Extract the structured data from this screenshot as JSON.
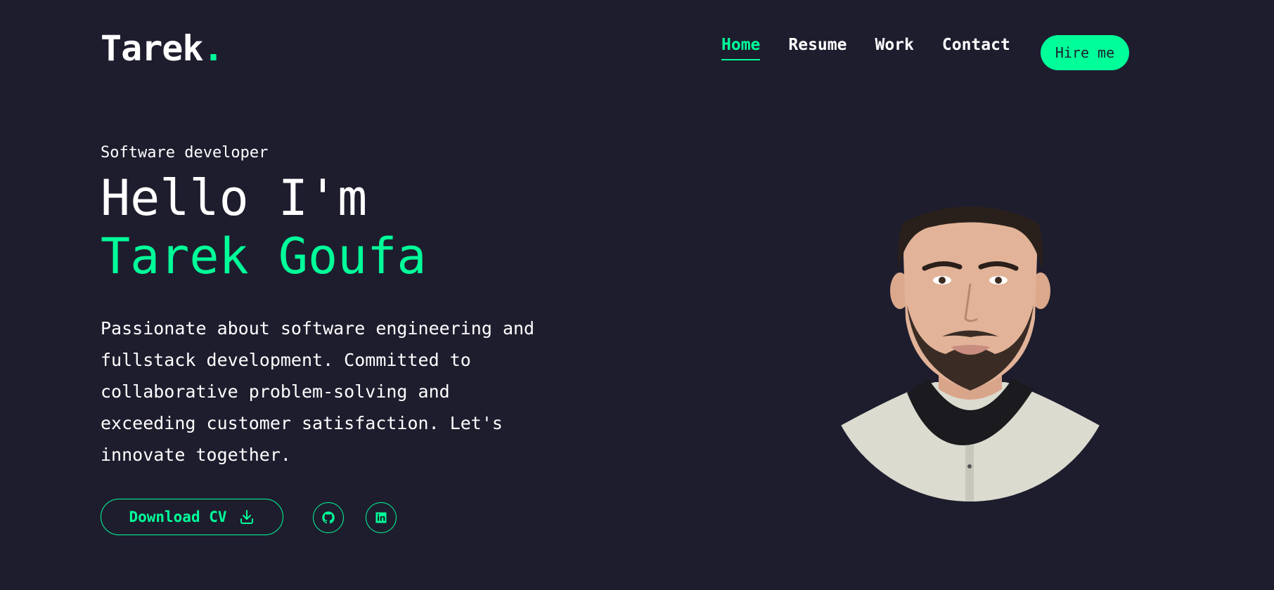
{
  "header": {
    "logo_text": "Tarek",
    "logo_dot": ".",
    "nav": [
      {
        "label": "Home",
        "active": true
      },
      {
        "label": "Resume",
        "active": false
      },
      {
        "label": "Work",
        "active": false
      },
      {
        "label": "Contact",
        "active": false
      }
    ],
    "hire_label": "Hire me"
  },
  "hero": {
    "eyebrow": "Software developer",
    "greeting": "Hello I'm",
    "name": "Tarek Goufa",
    "description": "Passionate about software engineering and fullstack development. Committed to collaborative problem-solving and exceeding customer satisfaction. Let's innovate together.",
    "cv_label": "Download CV",
    "cv_icon": "download-icon",
    "social": [
      {
        "icon": "github-icon"
      },
      {
        "icon": "linkedin-icon"
      }
    ],
    "photo_icon": "profile-photo"
  },
  "colors": {
    "background": "#1e1d2e",
    "accent": "#00ff99",
    "text": "#ffffff"
  }
}
